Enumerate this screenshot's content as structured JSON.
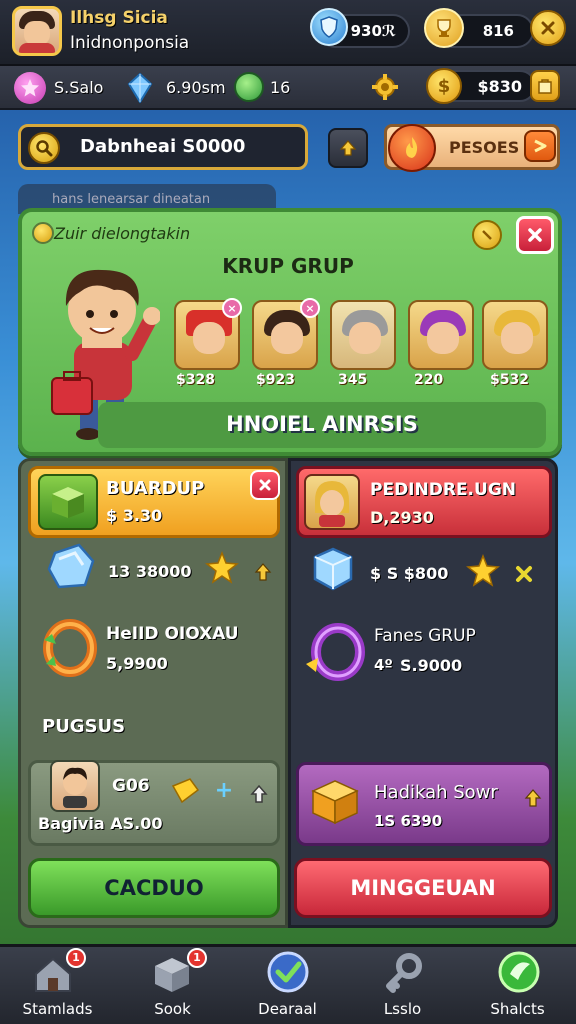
{
  "header": {
    "player_name": "Ilhsg Sicia",
    "player_country": "Inidnonponsia",
    "gems_value": "930ℛ",
    "trophy_value": "816"
  },
  "stats": {
    "level_label": "S.Salo",
    "crystal_value": "6.90sm",
    "shield_value": "16",
    "coins_value": "$830"
  },
  "search": {
    "value": "Dabnheai S0000",
    "pesos_label": "PESOES"
  },
  "ghost_tab": "hans lenearsar dineatan",
  "group_panel": {
    "header": "Zuir dielongtakin",
    "title": "KRUP GRUP",
    "members": [
      {
        "score": "$328"
      },
      {
        "score": "$923"
      },
      {
        "score": "345"
      },
      {
        "score": "220"
      },
      {
        "score": "$532"
      }
    ],
    "footer": "HNOIEL AINRSIS"
  },
  "left": {
    "card1_title": "BUARDUP",
    "card1_price": "$ 3.30",
    "item1_price": "13 38000",
    "item2_title": "HeIID OIOXAU",
    "item2_price": "5,9900",
    "section": "PUGSUS",
    "bottom_card_value": "G06",
    "bottom_card_caption": "Bagivia AS.00",
    "button": "CACDUO"
  },
  "right": {
    "card1_title": "PEDINDRE.UGN",
    "card1_price": "D,2930",
    "item1_price": "$ S $800",
    "item2_title": "Fanes GRUP",
    "item2_price": "S.9000",
    "item2_prefix": "4º",
    "bottom_card_title": "Hadikah Sowr",
    "bottom_card_price": "1S 6390",
    "button": "MINGGEUAN"
  },
  "nav": {
    "items": [
      {
        "label": "Stamlads",
        "badge": "1"
      },
      {
        "label": "Sook",
        "badge": "1"
      },
      {
        "label": "Dearaal",
        "badge": ""
      },
      {
        "label": "Lsslo",
        "badge": ""
      },
      {
        "label": "Shalcts",
        "badge": ""
      }
    ]
  },
  "colors": {
    "accent_gold": "#f5c84a",
    "group_green": "#5bb24d",
    "orange_card": "#f3a62a",
    "red_card": "#d8414a",
    "purple_card": "#9a5aa8",
    "green_button": "#4fbf3a",
    "red_button": "#d83a44"
  }
}
